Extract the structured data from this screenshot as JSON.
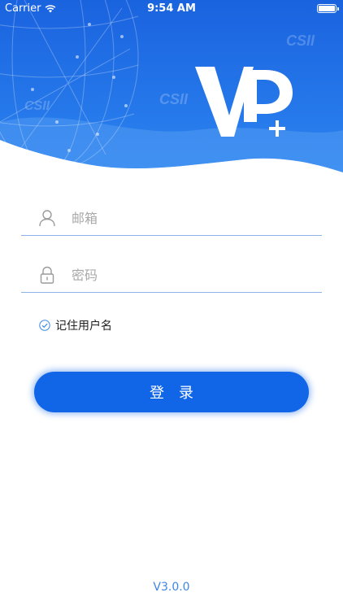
{
  "status_bar": {
    "carrier": "Carrier",
    "time": "9:54 AM"
  },
  "header": {
    "watermark_text": "CSII"
  },
  "form": {
    "email_placeholder": "邮箱",
    "password_placeholder": "密码",
    "remember_label": "记住用户名",
    "remember_checked": true,
    "login_label": "登录"
  },
  "footer": {
    "version": "V3.0.0"
  },
  "colors": {
    "brand_blue": "#1166e8",
    "underline": "#8fb3e8",
    "version_text": "#3d86e6"
  }
}
